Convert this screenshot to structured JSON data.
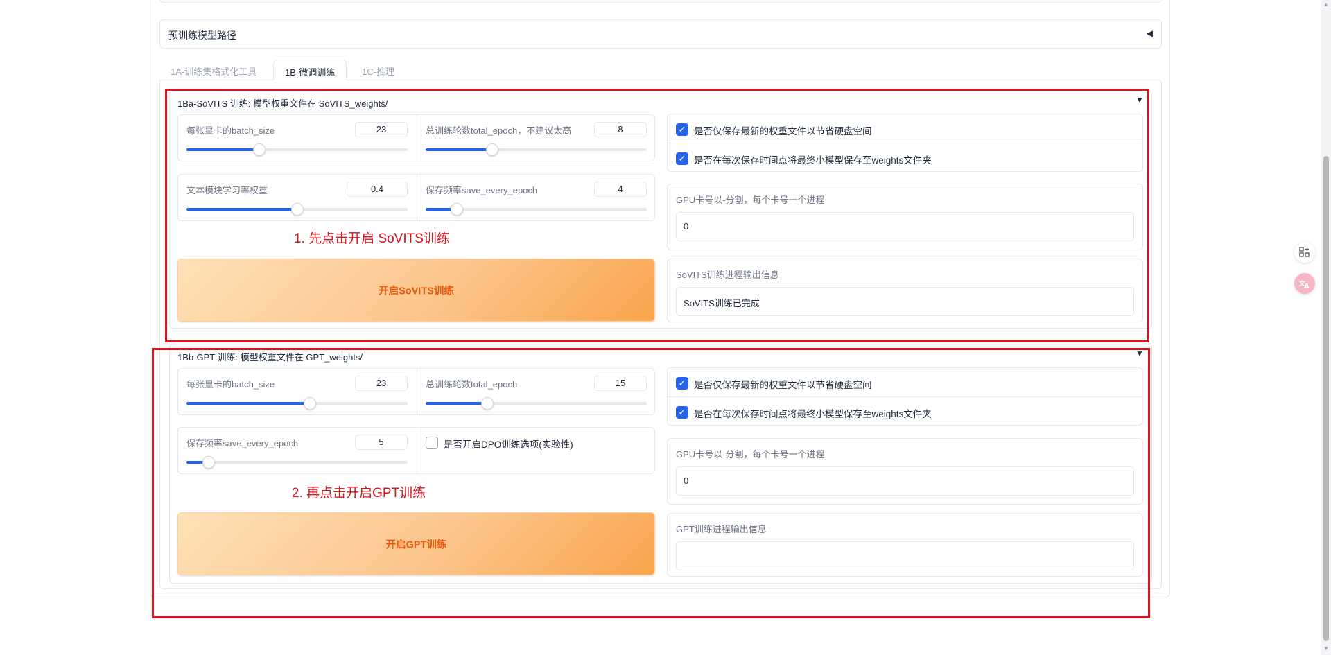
{
  "pretrained_accordion": {
    "label": "预训练模型路径",
    "caret": "◀"
  },
  "tabs": [
    {
      "label": "1A-训练集格式化工具"
    },
    {
      "label": "1B-微调训练"
    },
    {
      "label": "1C-推理"
    }
  ],
  "sovits": {
    "title": "1Ba-SoVITS 训练: 模型权重文件在 SoVITS_weights/",
    "caret": "▼",
    "batch_size": {
      "label": "每张显卡的batch_size",
      "value": "23",
      "fraction": 0.33
    },
    "total_epoch": {
      "label": "总训练轮数total_epoch，不建议太高",
      "value": "8",
      "fraction": 0.3
    },
    "text_lr": {
      "label": "文本模块学习率权重",
      "value": "0.4",
      "fraction": 0.5
    },
    "save_every": {
      "label": "保存频率save_every_epoch",
      "value": "4",
      "fraction": 0.14
    },
    "save_latest": {
      "label": "是否仅保存最新的权重文件以节省硬盘空间",
      "checked": true
    },
    "save_small": {
      "label": "是否在每次保存时间点将最终小模型保存至weights文件夹",
      "checked": true
    },
    "gpu": {
      "label": "GPU卡号以-分割，每个卡号一个进程",
      "value": "0"
    },
    "output": {
      "label": "SoVITS训练进程输出信息",
      "value": "SoVITS训练已完成"
    },
    "start_button": "开启SoVITS训练"
  },
  "gpt": {
    "title": "1Bb-GPT 训练: 模型权重文件在 GPT_weights/",
    "caret": "▼",
    "batch_size": {
      "label": "每张显卡的batch_size",
      "value": "23",
      "fraction": 0.56
    },
    "total_epoch": {
      "label": "总训练轮数total_epoch",
      "value": "15",
      "fraction": 0.28
    },
    "save_every": {
      "label": "保存频率save_every_epoch",
      "value": "5",
      "fraction": 0.1
    },
    "dpo": {
      "label": "是否开启DPO训练选项(实验性)",
      "checked": false
    },
    "save_latest": {
      "label": "是否仅保存最新的权重文件以节省硬盘空间",
      "checked": true
    },
    "save_small": {
      "label": "是否在每次保存时间点将最终小模型保存至weights文件夹",
      "checked": true
    },
    "gpu": {
      "label": "GPU卡号以-分割，每个卡号一个进程",
      "value": "0"
    },
    "output": {
      "label": "GPT训练进程输出信息",
      "value": ""
    },
    "start_button": "开启GPT训练"
  },
  "annotations": {
    "step1": "1. 先点击开启 SoVITS训练",
    "step2": "2. 再点击开启GPT训练",
    "color": "#d9141d"
  },
  "colors": {
    "accent": "#2563eb",
    "button_text": "#ea580c"
  },
  "floating_icons": [
    "grid-plus-icon",
    "translate-icon"
  ]
}
